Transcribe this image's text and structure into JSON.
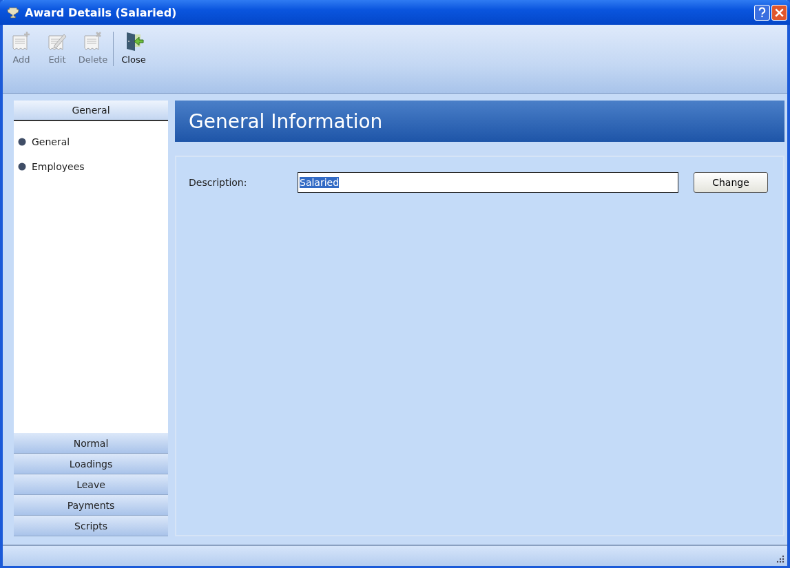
{
  "window": {
    "title": "Award Details (Salaried)"
  },
  "toolbar": [
    {
      "label": "Add",
      "kind": "add",
      "disabled": true
    },
    {
      "label": "Edit",
      "kind": "edit",
      "disabled": true
    },
    {
      "label": "Delete",
      "kind": "delete",
      "disabled": true
    },
    {
      "label": "Close",
      "kind": "close",
      "disabled": false
    }
  ],
  "sidebar": {
    "sections": [
      {
        "label": "General",
        "expanded": true,
        "items": [
          "General",
          "Employees"
        ]
      },
      {
        "label": "Normal",
        "expanded": false
      },
      {
        "label": "Loadings",
        "expanded": false
      },
      {
        "label": "Leave",
        "expanded": false
      },
      {
        "label": "Payments",
        "expanded": false
      },
      {
        "label": "Scripts",
        "expanded": false
      }
    ]
  },
  "panel": {
    "title": "General Information",
    "description": {
      "label": "Description:",
      "value": "Salaried",
      "selected": true
    },
    "button": "Change"
  }
}
